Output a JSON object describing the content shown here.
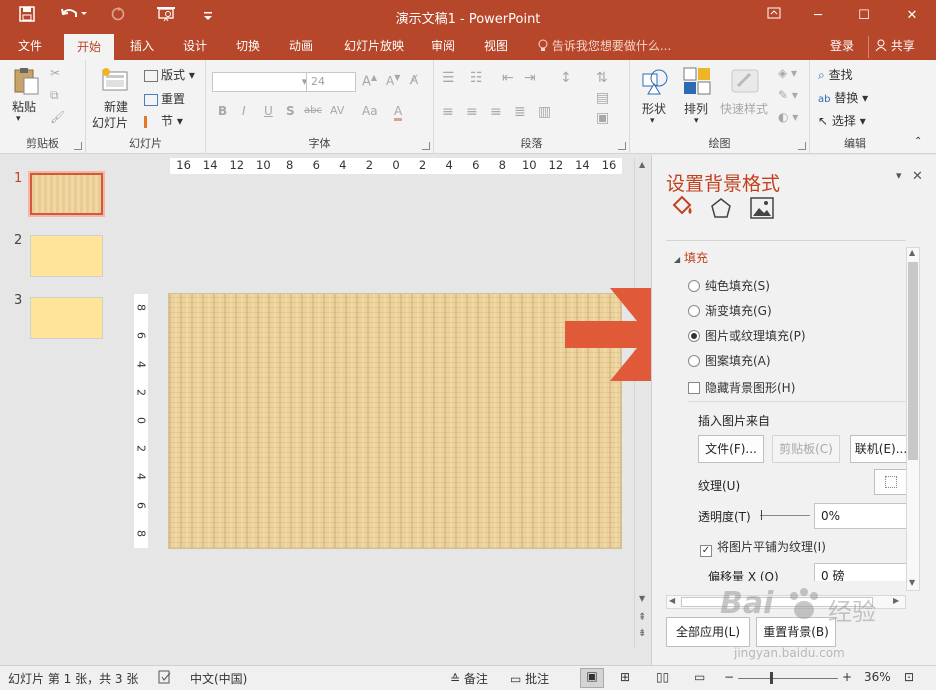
{
  "titlebar": {
    "title": "演示文稿1 - PowerPoint",
    "save_icon": "save-icon",
    "undo_icon": "undo-icon",
    "redo_icon": "redo-icon",
    "present_icon": "present-from-start-icon",
    "customize_icon": "customize-qat-icon"
  },
  "window_buttons": {
    "ribbon_display": "ribbon-display-icon",
    "minimize": "─",
    "maximize": "☐",
    "close": "✕"
  },
  "menu": {
    "tabs": [
      "文件",
      "开始",
      "插入",
      "设计",
      "切换",
      "动画",
      "幻灯片放映",
      "审阅",
      "视图"
    ],
    "active_tab": "开始",
    "tellme": "告诉我您想要做什么...",
    "login": "登录",
    "share": "共享"
  },
  "ribbon": {
    "clipboard": {
      "label": "剪贴板",
      "paste": "粘贴"
    },
    "slides": {
      "label": "幻灯片",
      "new_slide_1": "新建",
      "new_slide_2": "幻灯片",
      "layout": "版式",
      "reset": "重置",
      "section": "节"
    },
    "font": {
      "label": "字体",
      "font_name": "",
      "font_size": "24",
      "bold": "B",
      "italic": "I",
      "underline": "U",
      "shadow": "S",
      "strike": "abc",
      "spacing": "AV",
      "case": "Aa",
      "color": "A"
    },
    "paragraph": {
      "label": "段落"
    },
    "drawing": {
      "label": "绘图",
      "shape": "形状",
      "arrange": "排列",
      "quick_styles": "快速样式"
    },
    "editing": {
      "label": "编辑",
      "find": "查找",
      "replace": "替换",
      "select": "选择"
    }
  },
  "thumbnails": [
    {
      "number": "1",
      "selected": true
    },
    {
      "number": "2",
      "selected": false
    },
    {
      "number": "3",
      "selected": false
    }
  ],
  "rulers": {
    "horizontal": [
      "16",
      "14",
      "12",
      "10",
      "8",
      "6",
      "4",
      "2",
      "0",
      "2",
      "4",
      "6",
      "8",
      "10",
      "12",
      "14",
      "16"
    ],
    "vertical": [
      "8",
      "6",
      "4",
      "2",
      "0",
      "2",
      "4",
      "6",
      "8"
    ]
  },
  "pane": {
    "title": "设置背景格式",
    "fill_section": "填充",
    "options": {
      "solid": "纯色填充(S)",
      "gradient": "渐变填充(G)",
      "picture": "图片或纹理填充(P)",
      "pattern": "图案填充(A)"
    },
    "selected_option": "picture",
    "hide_bg": "隐藏背景图形(H)",
    "insert_from": "插入图片来自",
    "buttons": {
      "file": "文件(F)...",
      "clipboard": "剪贴板(C)",
      "online": "联机(E)..."
    },
    "texture_label": "纹理(U)",
    "transparency_label": "透明度(T)",
    "transparency_value": "0%",
    "tile_label": "将图片平铺为纹理(I)",
    "tile_checked": true,
    "offset_x_label": "偏移量 X (O)",
    "offset_x_value": "0 磅",
    "apply_all": "全部应用(L)",
    "reset_bg": "重置背景(B)"
  },
  "statusbar": {
    "slide_info": "幻灯片 第 1 张，共 3 张",
    "language": "中文(中国)",
    "notes": "备注",
    "comments": "批注",
    "zoom": "36%"
  },
  "watermark": {
    "text_1": "Bai",
    "text_2": "经验",
    "url": "jingyan.baidu.com"
  },
  "colors": {
    "accent": "#b7472a",
    "pane_title": "#c4411f",
    "arrow": "#e05a3a",
    "slide_bg": "#ecd39e",
    "thumb_bg": "#ffe49a"
  }
}
